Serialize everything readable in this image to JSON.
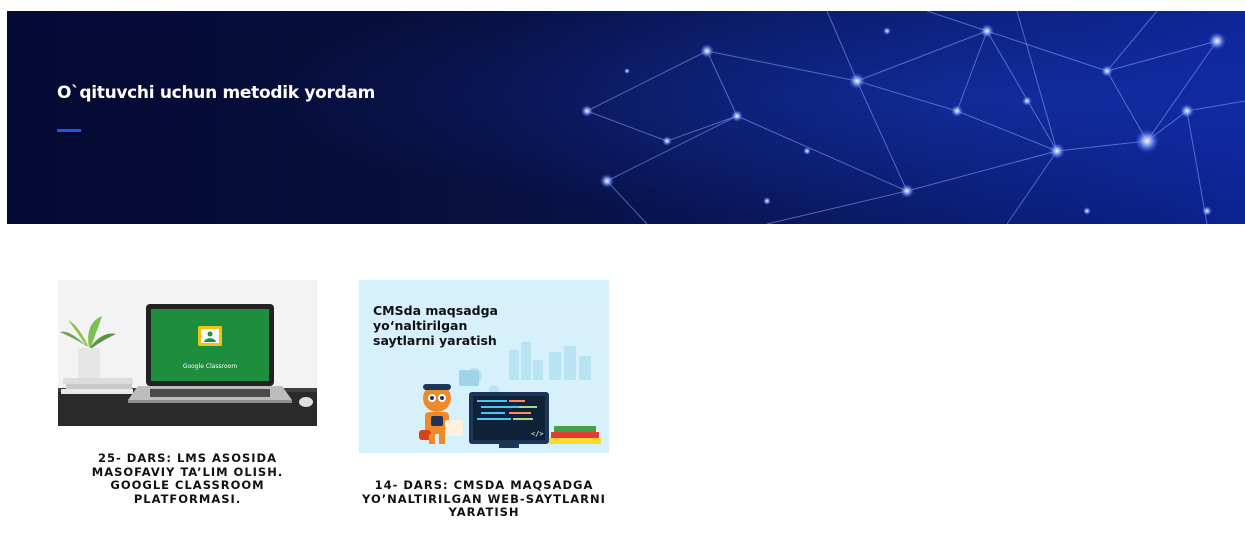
{
  "hero": {
    "title": "O`qituvchi uchun metodik yordam"
  },
  "cards": [
    {
      "title": "25- DARS: LMS ASOSIDA MASOFAVIY TA’LIM OLISH. GOOGLE CLASSROOM PLATFORMASI.",
      "image": {
        "screen_text": "Google Classroom"
      }
    },
    {
      "title": "14- DARS: CMSDA MAQSADGA YO’NALTIRILGAN WEB-SAYTLARNI YARATISH",
      "image": {
        "caption_line1": "CMSda maqsadga",
        "caption_line2": "yo‘naltirilgan",
        "caption_line3": "saytlarni yaratish"
      }
    }
  ],
  "colors": {
    "hero_bg": "#050a33",
    "accent": "#1f57e0",
    "classroom_green": "#1e8e3e",
    "card2_bg": "#d6f1fb"
  }
}
